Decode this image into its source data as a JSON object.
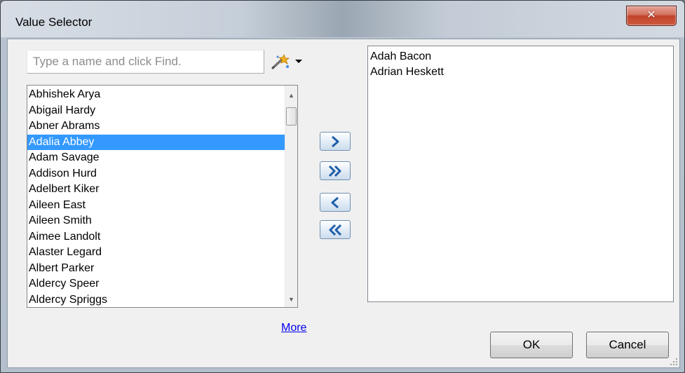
{
  "window": {
    "title": "Value Selector",
    "close_glyph": "✕"
  },
  "search": {
    "value": "",
    "placeholder": "Type a name and click Find."
  },
  "available": {
    "items": [
      "Abhishek Arya",
      "Abigail Hardy",
      "Abner Abrams",
      "Adalia Abbey",
      "Adam Savage",
      "Addison Hurd",
      "Adelbert Kiker",
      "Aileen East",
      "Aileen Smith",
      "Aimee Landolt",
      "Alaster Legard",
      "Albert Parker",
      "Aldercy Speer",
      "Aldercy Spriggs"
    ],
    "selected_item": "Adalia Abbey",
    "scroll_position": 0.05
  },
  "selected": {
    "items": [
      "Adah Bacon",
      "Adrian Heskett"
    ]
  },
  "move_buttons": {
    "add_icon": "chevron-right-icon",
    "add_all_icon": "double-chevron-right-icon",
    "remove_icon": "chevron-left-icon",
    "remove_all_icon": "double-chevron-left-icon"
  },
  "more_link": "More",
  "buttons": {
    "ok": "OK",
    "cancel": "Cancel"
  },
  "colors": {
    "selection": "#3399ff",
    "link": "#0000ee",
    "close_button": "#c1432b",
    "arrow": "#1f5fa8"
  }
}
